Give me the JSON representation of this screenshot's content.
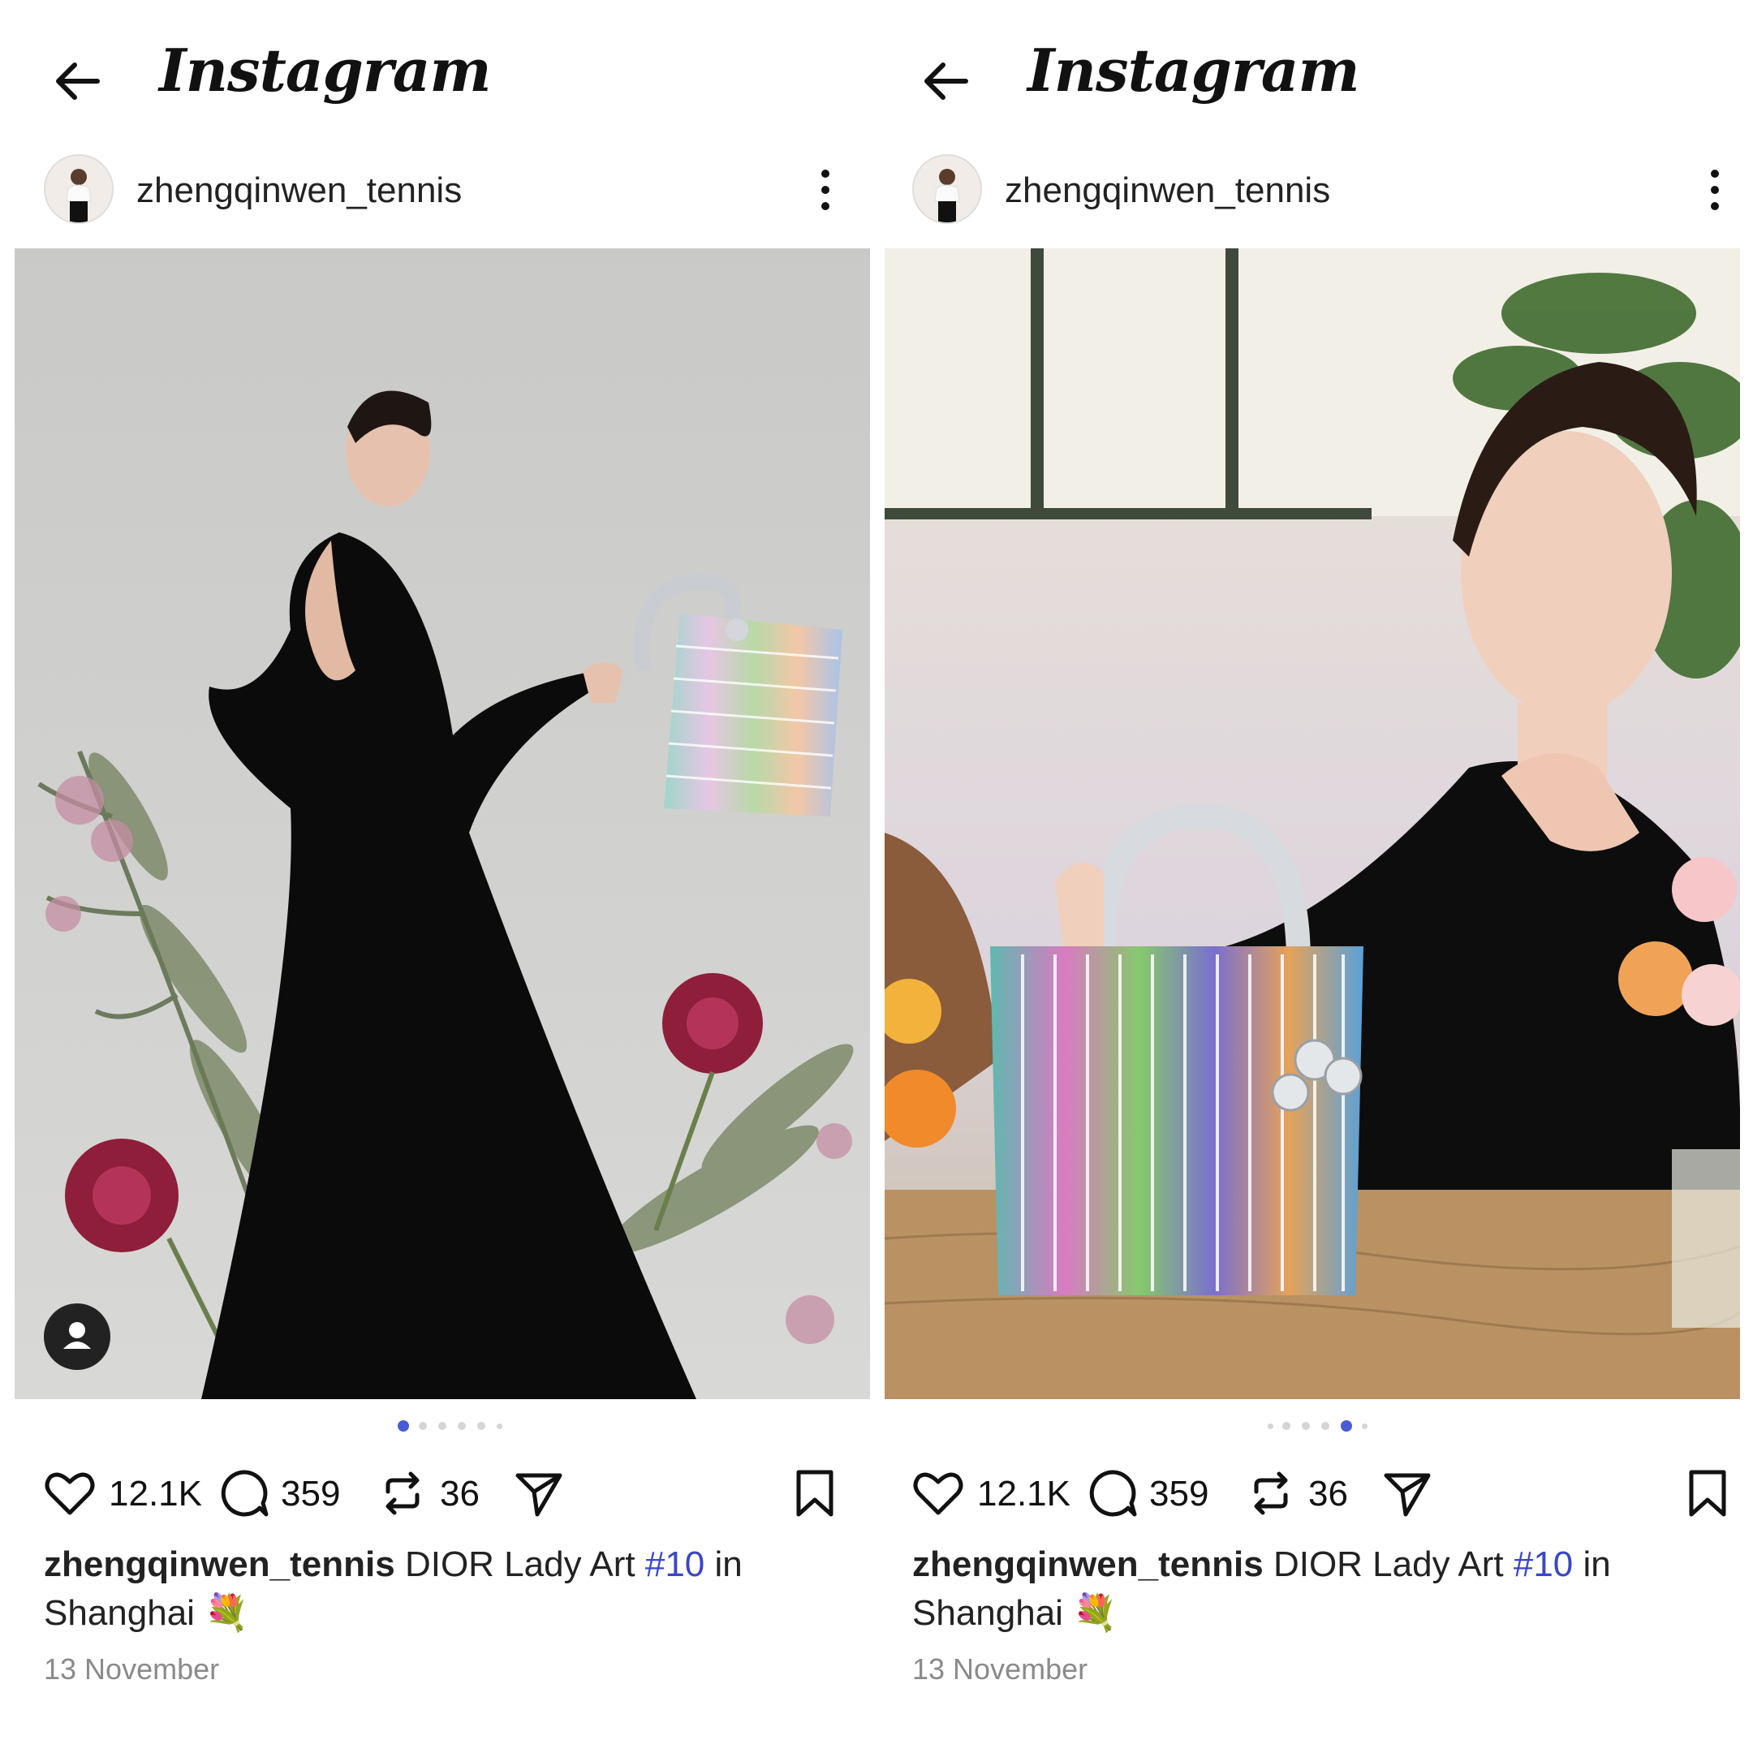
{
  "posts": [
    {
      "app_title": "Instagram",
      "username": "zhengqinwen_tennis",
      "likes": "12.1K",
      "comments": "359",
      "reposts": "36",
      "caption_user": "zhengqinwen_tennis",
      "caption_text": "DIOR Lady Art",
      "caption_tag": "#10",
      "caption_rest": "in",
      "caption_line2": "Shanghai",
      "emoji": "💐",
      "date": "13 November",
      "active_dot": 1,
      "total_dots": 6
    },
    {
      "app_title": "Instagram",
      "username": "zhengqinwen_tennis",
      "likes": "12.1K",
      "comments": "359",
      "reposts": "36",
      "caption_user": "zhengqinwen_tennis",
      "caption_text": "DIOR Lady Art",
      "caption_tag": "#10",
      "caption_rest": "in",
      "caption_line2": "Shanghai",
      "emoji": "💐",
      "date": "13 November",
      "active_dot": 5,
      "total_dots": 6
    }
  ],
  "icons": {
    "back": "arrow-left-icon",
    "more": "more-vertical-icon",
    "like": "heart-icon",
    "comment": "comment-icon",
    "repost": "repost-icon",
    "share": "send-icon",
    "save": "bookmark-icon",
    "tagged_user": "user-icon"
  },
  "colors": {
    "hashtag": "#3a46c9",
    "active_dot": "#4a5bd6",
    "inactive_dot": "#d5d5d5",
    "date_gray": "#8a8a8a"
  }
}
